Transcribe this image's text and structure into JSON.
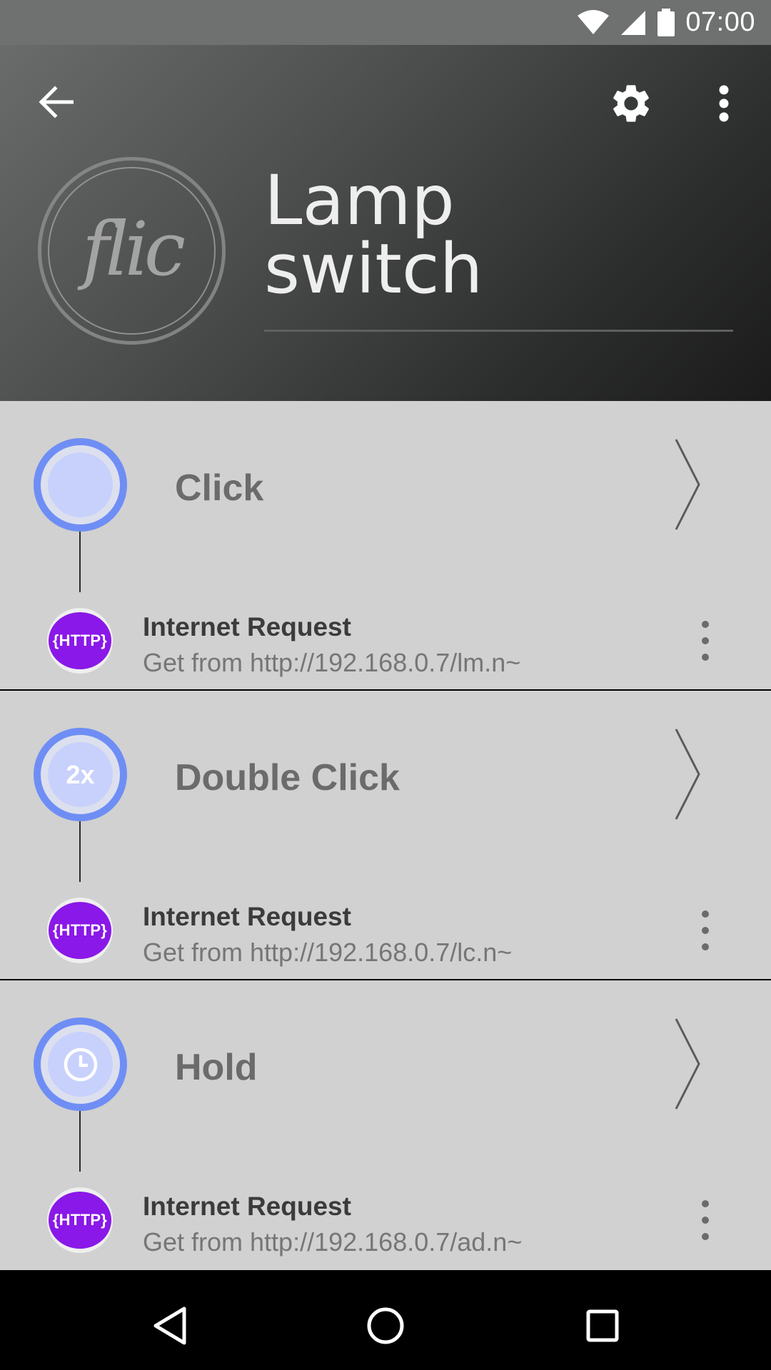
{
  "status_bar": {
    "time": "07:00",
    "icons": [
      "wifi-icon",
      "cell-signal-icon",
      "battery-icon"
    ]
  },
  "toolbar": {
    "back_icon": "arrow-back-icon",
    "settings_icon": "gear-icon",
    "more_icon": "more-vertical-icon"
  },
  "button": {
    "logo_text": "flic",
    "name_line1": "Lamp",
    "name_line2": "switch"
  },
  "sections": [
    {
      "trigger_label": "Click",
      "trigger_icon_text": "",
      "action": {
        "badge": "{HTTP}",
        "title": "Internet Request",
        "subtitle": "Get from http://192.168.0.7/lm.n~"
      }
    },
    {
      "trigger_label": "Double Click",
      "trigger_icon_text": "2x",
      "action": {
        "badge": "{HTTP}",
        "title": "Internet Request",
        "subtitle": "Get from http://192.168.0.7/lc.n~"
      }
    },
    {
      "trigger_label": "Hold",
      "trigger_icon_text": "",
      "action": {
        "badge": "{HTTP}",
        "title": "Internet Request",
        "subtitle": "Get from http://192.168.0.7/ad.n~"
      }
    }
  ],
  "colors": {
    "trigger_ring": "#6f8ef5",
    "http_badge": "#8a18e8",
    "section_bg": "#d1d1d1"
  },
  "nav_bar": {
    "icons": [
      "nav-back-icon",
      "nav-home-icon",
      "nav-recents-icon"
    ]
  }
}
